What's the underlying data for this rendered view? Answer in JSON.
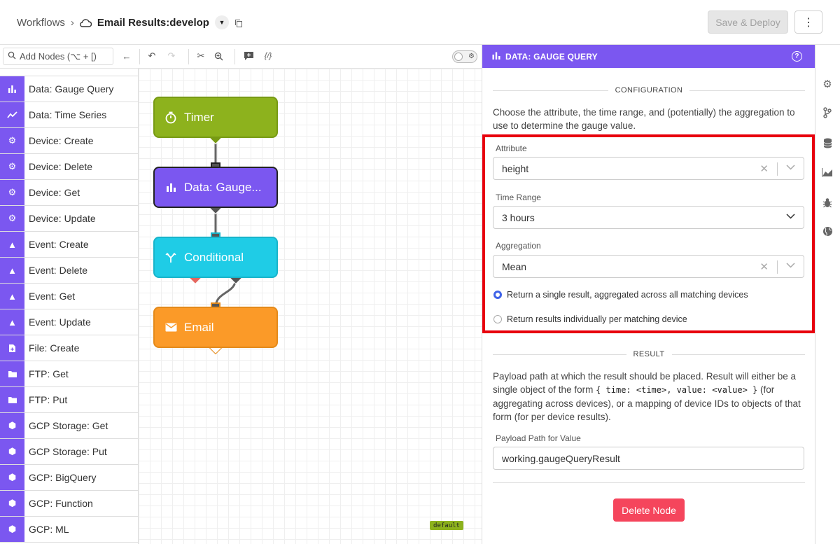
{
  "header": {
    "breadcrumb_root": "Workflows",
    "breadcrumb_sep": "›",
    "workflow_name": "Email Results:develop",
    "save_label": "Save & Deploy",
    "more_label": "⋮"
  },
  "toolbar": {
    "search_placeholder": "Add Nodes (⌥ + [)"
  },
  "palette": {
    "items": [
      {
        "label": "Data: Gauge Query",
        "icon": "bar-chart-icon"
      },
      {
        "label": "Data: Time Series",
        "icon": "line-chart-icon"
      },
      {
        "label": "Device: Create",
        "icon": "device-icon"
      },
      {
        "label": "Device: Delete",
        "icon": "device-icon"
      },
      {
        "label": "Device: Get",
        "icon": "device-icon"
      },
      {
        "label": "Device: Update",
        "icon": "device-icon"
      },
      {
        "label": "Event: Create",
        "icon": "warning-icon"
      },
      {
        "label": "Event: Delete",
        "icon": "warning-icon"
      },
      {
        "label": "Event: Get",
        "icon": "warning-icon"
      },
      {
        "label": "Event: Update",
        "icon": "warning-icon"
      },
      {
        "label": "File: Create",
        "icon": "file-icon"
      },
      {
        "label": "FTP: Get",
        "icon": "folder-icon"
      },
      {
        "label": "FTP: Put",
        "icon": "folder-icon"
      },
      {
        "label": "GCP Storage: Get",
        "icon": "gcp-icon"
      },
      {
        "label": "GCP Storage: Put",
        "icon": "gcp-icon"
      },
      {
        "label": "GCP: BigQuery",
        "icon": "gcp-icon"
      },
      {
        "label": "GCP: Function",
        "icon": "gcp-icon"
      },
      {
        "label": "GCP: ML",
        "icon": "gcp-icon"
      }
    ]
  },
  "canvas": {
    "nodes": {
      "timer": "Timer",
      "gauge": "Data: Gauge...",
      "conditional": "Conditional",
      "email": "Email"
    },
    "default_tag": "default"
  },
  "panel": {
    "title": "DATA: GAUGE QUERY",
    "configuration_heading": "CONFIGURATION",
    "configuration_text": "Choose the attribute, the time range, and (potentially) the aggregation to use to determine the gauge value.",
    "attribute_label": "Attribute",
    "attribute_value": "height",
    "time_range_label": "Time Range",
    "time_range_value": "3 hours",
    "aggregation_label": "Aggregation",
    "aggregation_value": "Mean",
    "radio_single": "Return a single result, aggregated across all matching devices",
    "radio_individual": "Return results individually per matching device",
    "radio_selected": "single",
    "result_heading": "RESULT",
    "result_text_1": "Payload path at which the result should be placed. Result will either be a single object of the form ",
    "result_code": "{ time: <time>, value: <value> }",
    "result_text_2": " (for aggregating across devices), or a mapping of device IDs to objects of that form (for per device results).",
    "payload_label": "Payload Path for Value",
    "payload_value": "working.gaugeQueryResult",
    "delete_label": "Delete Node"
  },
  "colors": {
    "accent": "#7b57f0",
    "timer": "#8db21d",
    "conditional": "#1fcce6",
    "email": "#fb9a28",
    "delete": "#f5455c",
    "highlight": "#e8000d"
  }
}
